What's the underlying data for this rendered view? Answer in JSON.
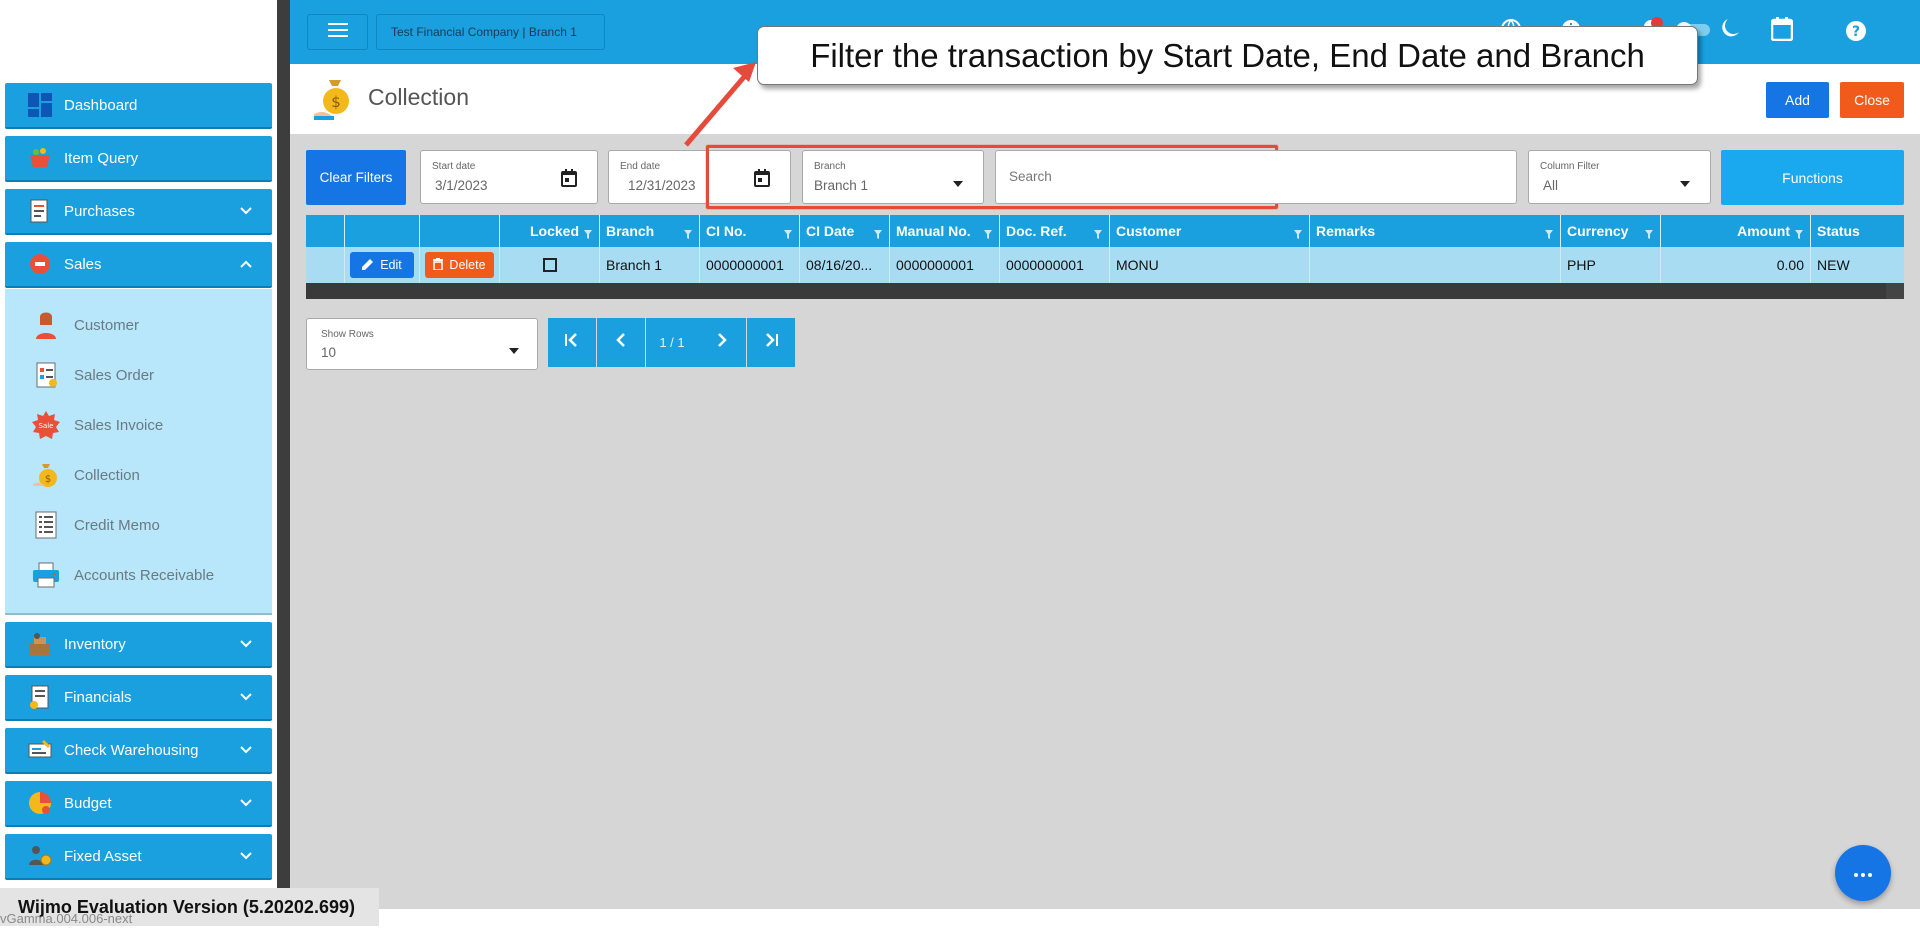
{
  "topbar": {
    "company": "Test Financial Company | Branch 1"
  },
  "sidebar": {
    "items": [
      {
        "label": "Dashboard"
      },
      {
        "label": "Item Query"
      },
      {
        "label": "Purchases"
      },
      {
        "label": "Sales"
      },
      {
        "label": "Inventory"
      },
      {
        "label": "Financials"
      },
      {
        "label": "Check Warehousing"
      },
      {
        "label": "Budget"
      },
      {
        "label": "Fixed Asset"
      }
    ],
    "sales_sub": [
      {
        "label": "Customer"
      },
      {
        "label": "Sales Order"
      },
      {
        "label": "Sales Invoice"
      },
      {
        "label": "Collection"
      },
      {
        "label": "Credit Memo"
      },
      {
        "label": "Accounts Receivable"
      }
    ]
  },
  "page": {
    "title": "Collection",
    "add_label": "Add",
    "close_label": "Close"
  },
  "filters": {
    "clear_label": "Clear Filters",
    "start_date": {
      "label": "Start date",
      "value": "3/1/2023"
    },
    "end_date": {
      "label": "End date",
      "value": "12/31/2023"
    },
    "branch": {
      "label": "Branch",
      "value": "Branch 1"
    },
    "search_placeholder": "Search",
    "column_filter": {
      "label": "Column Filter",
      "value": "All"
    },
    "functions_label": "Functions"
  },
  "grid": {
    "headers": [
      "Locked",
      "Branch",
      "CI No.",
      "CI Date",
      "Manual No.",
      "Doc. Ref.",
      "Customer",
      "Remarks",
      "Currency",
      "Amount",
      "Status"
    ],
    "edit_label": "Edit",
    "delete_label": "Delete",
    "row": {
      "branch": "Branch 1",
      "ci_no": "0000000001",
      "ci_date": "08/16/20...",
      "manual_no": "0000000001",
      "doc_ref": "0000000001",
      "customer": "MONU",
      "remarks": "",
      "currency": "PHP",
      "amount": "0.00",
      "status": "NEW"
    }
  },
  "pager": {
    "show_rows_label": "Show Rows",
    "show_rows_value": "10",
    "page_info": "1 / 1"
  },
  "callout": {
    "text": "Filter the transaction by Start Date, End Date and Branch"
  },
  "footer": {
    "wijmo": "Wijmo Evaluation Version (5.20202.699)",
    "version": "vGamma.004.006-next"
  },
  "colors": {
    "primary": "#1aa0df",
    "blue_button": "#1575e4",
    "danger": "#f25a1c",
    "highlight": "#e64a3b",
    "sidebar_sub_bg": "#b8e6fa"
  }
}
